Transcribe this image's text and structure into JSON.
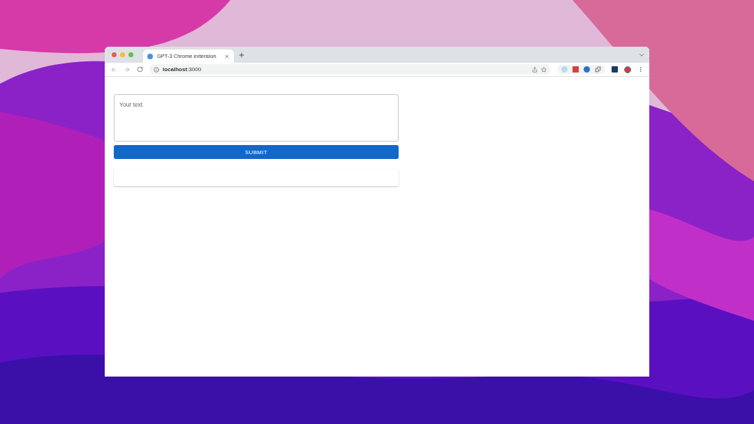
{
  "browser": {
    "tabs": [
      {
        "title": "GPT-3 Chrome extension",
        "selected": true
      }
    ],
    "address": "**localhost**:3000"
  },
  "page": {
    "prompt": {
      "placeholder": "Your text"
    },
    "submit": {
      "label": "SUBMIT"
    }
  }
}
